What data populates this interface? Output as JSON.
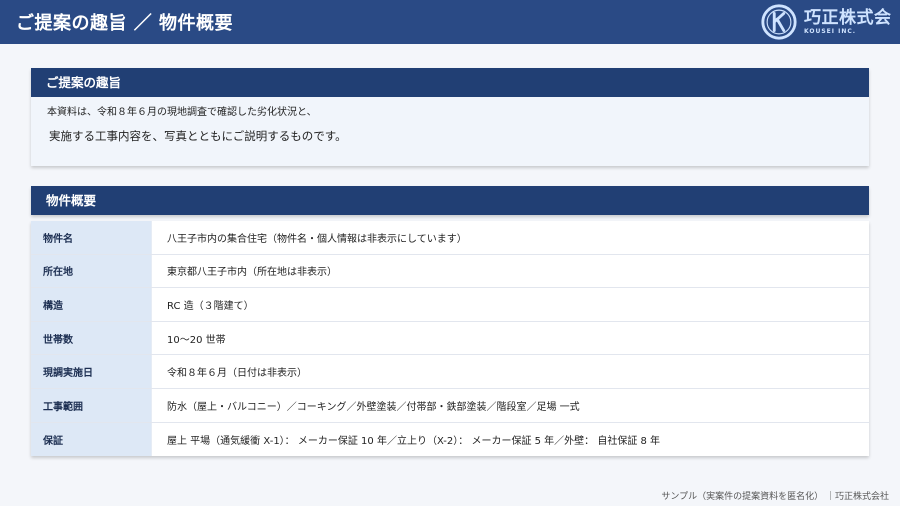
{
  "header": {
    "title": "ご提案の趣旨 ／ 物件概要",
    "logo_name": "巧正株式会",
    "logo_sub": "KOUSEI INC.",
    "brand_color": "#2a4a85"
  },
  "intro": {
    "heading": "ご提案の趣旨",
    "line1": "本資料は、令和８年６月の現地調査で確認した劣化状況と、",
    "line2": "実施する工事内容を、写真とともにご説明するものです。"
  },
  "property": {
    "heading": "物件概要",
    "rows": [
      {
        "label": "物件名",
        "value": "八王子市内の集合住宅（物件名・個人情報は非表示にしています）"
      },
      {
        "label": "所在地",
        "value": "東京都八王子市内（所在地は非表示）"
      },
      {
        "label": "構造",
        "value": "RC 造（３階建て）"
      },
      {
        "label": "世帯数",
        "value": "10〜20 世帯"
      },
      {
        "label": "現調実施日",
        "value": "令和８年６月（日付は非表示）"
      },
      {
        "label": "工事範囲",
        "value": "防水（屋上・バルコニー）／コーキング／外壁塗装／付帯部・鉄部塗装／階段室／足場 一式"
      },
      {
        "label": "保証",
        "value": "屋上 平場（通気緩衝 X-1）： メーカー保証 10 年／立上り（X-2）： メーカー保証 5 年／外壁： 自社保証 8 年"
      }
    ]
  },
  "footer": {
    "text": "サンプル（実案件の提案資料を匿名化） ｜巧正株式会社"
  }
}
